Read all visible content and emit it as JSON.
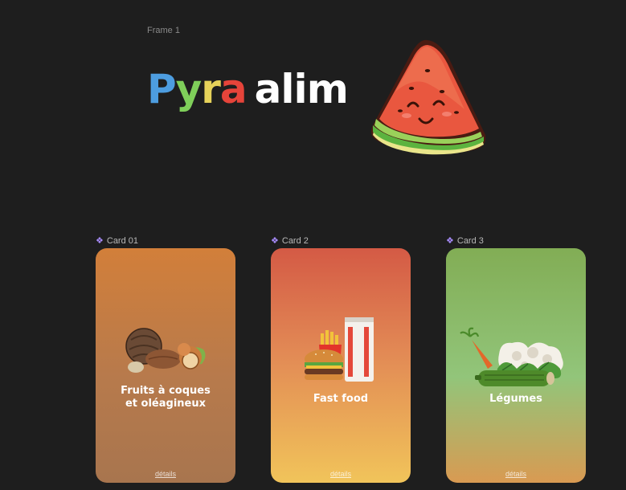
{
  "frame": {
    "label": "Frame 1"
  },
  "logo": {
    "parts": [
      "P",
      "y",
      "r",
      "a",
      "alim"
    ],
    "colors": [
      "#4d9de0",
      "#7fcf5a",
      "#e6d25a",
      "#e6443a",
      "#ffffff"
    ],
    "mascot_icon": "watermelon-slice-icon"
  },
  "cards": [
    {
      "component_label": "Card 01",
      "title_line1": "Fruits à coques",
      "title_line2": "et oléagineux",
      "link": "détails",
      "icon": "nuts-icon",
      "gradient": [
        "#d27f3a",
        "#a8754e"
      ]
    },
    {
      "component_label": "Card 2",
      "title_line1": "Fast food",
      "link": "détails",
      "icon": "burger-fries-drink-icon",
      "gradient": [
        "#d45a45",
        "#f1c45a"
      ]
    },
    {
      "component_label": "Card 3",
      "title_line1": "Légumes",
      "link": "détails",
      "icon": "vegetables-icon",
      "gradient": [
        "#82ad55",
        "#d99a52"
      ]
    }
  ]
}
